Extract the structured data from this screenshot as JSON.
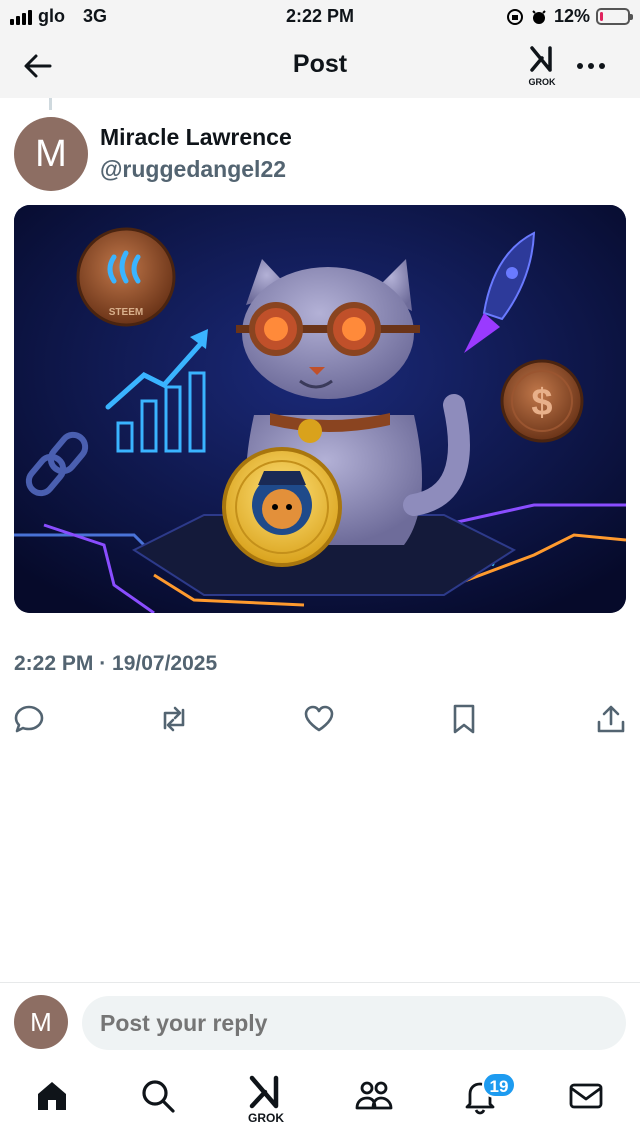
{
  "status_bar": {
    "carrier": "glo",
    "network": "3G",
    "time": "2:22 PM",
    "battery_percent": "12%",
    "battery_level": 0.12,
    "battery_color": "#e0245e"
  },
  "header": {
    "title": "Post",
    "grok_label": "GROK"
  },
  "post": {
    "avatar_letter": "M",
    "author_name": "Miracle Lawrence",
    "author_handle": "@ruggedangel22",
    "image_coin_text": "STEEM",
    "timestamp": "2:22 PM · 19/07/2025"
  },
  "actions": [
    "reply-icon",
    "repost-icon",
    "like-icon",
    "bookmark-icon",
    "share-icon"
  ],
  "reply": {
    "avatar_letter": "M",
    "placeholder": "Post your reply"
  },
  "bottom_nav": {
    "grok_label": "GROK",
    "notifications_count": "19"
  },
  "colors": {
    "accent": "#1d9bf0",
    "secondary_text": "#536471",
    "avatar_bg": "#8d6e63"
  }
}
